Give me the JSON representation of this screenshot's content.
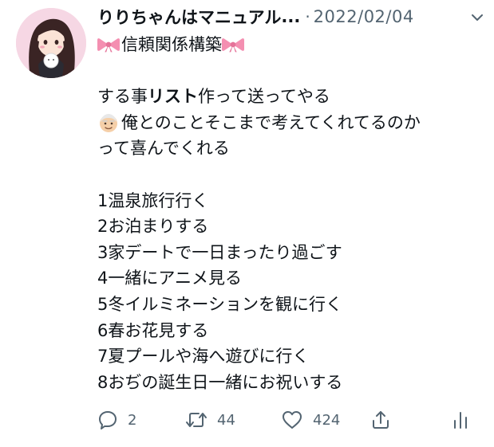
{
  "tweet": {
    "author": {
      "display_name": "りりちゃんはマニュアル",
      "name_ellipsis": "...",
      "avatar_icon": "avatar-girl-icon"
    },
    "separator": "·",
    "date": "2022/02/04",
    "more_icon": "chevron-down-icon",
    "title": {
      "left_icon": "ribbon-icon",
      "text": "信頼関係構築",
      "right_icon": "ribbon-icon"
    },
    "body": {
      "line1_pre": "する事",
      "line1_bold": "リスト",
      "line1_post": "作って送ってやる",
      "line2_icon": "old-man-face-icon",
      "line2_text": "俺とのことそこまで考えてくれてるのか",
      "line3_text": "って喜んでくれる"
    },
    "list": [
      "1温泉旅行行く",
      "2お泊まりする",
      "3家デートで一日まったり過ごす",
      "4一緒にアニメ見る",
      "5冬イルミネーションを観に行く",
      "6春お花見する",
      "7夏プールや海へ遊びに行く",
      "8おぢの誕生日一緒にお祝いする"
    ],
    "actions": {
      "reply": {
        "icon": "reply-icon",
        "count": "2"
      },
      "retweet": {
        "icon": "retweet-icon",
        "count": "44"
      },
      "like": {
        "icon": "heart-icon",
        "count": "424"
      },
      "share": {
        "icon": "share-icon"
      },
      "analytics": {
        "icon": "analytics-icon"
      }
    },
    "colors": {
      "text": "#0f1419",
      "secondary": "#536471",
      "ribbon": "#f48fb1",
      "avatar_bg": "#f6d7e4"
    }
  }
}
